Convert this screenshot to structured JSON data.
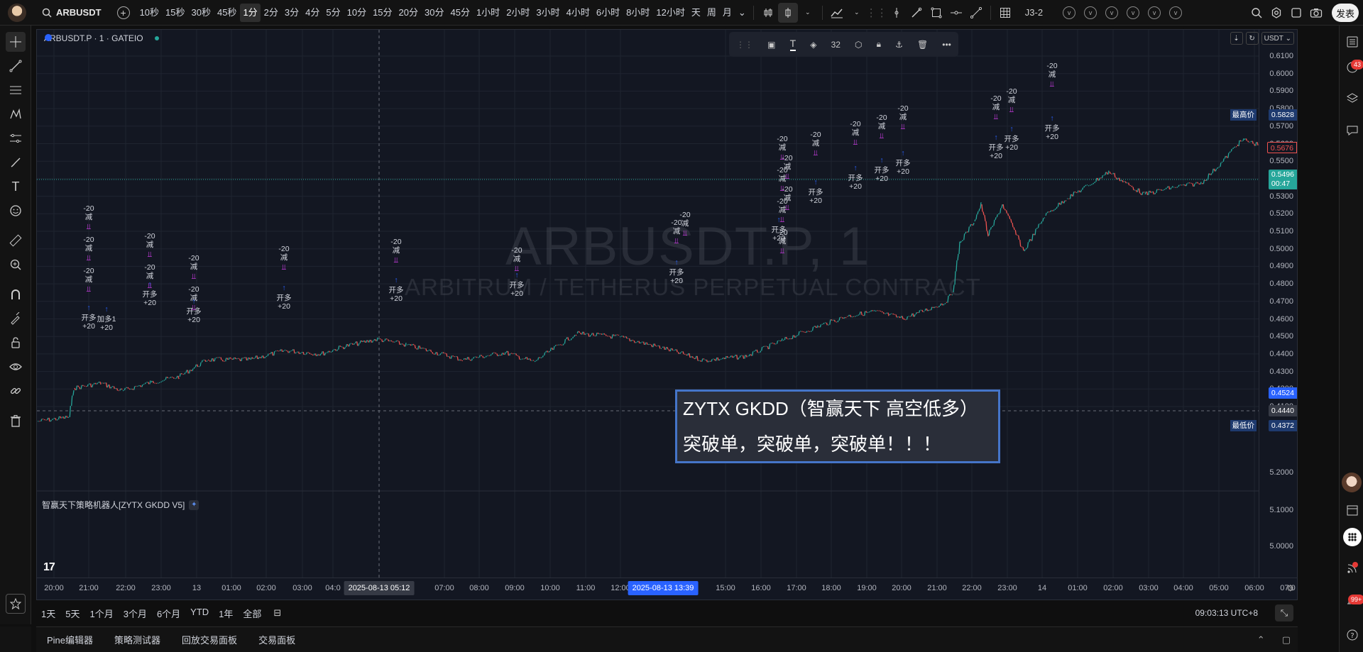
{
  "topbar": {
    "symbol": "ARBUSDT",
    "intervals": [
      "10秒",
      "15秒",
      "30秒",
      "45秒",
      "1分",
      "2分",
      "3分",
      "4分",
      "5分",
      "10分",
      "15分",
      "20分",
      "30分",
      "45分",
      "1小时",
      "2小时",
      "3小时",
      "4小时",
      "6小时",
      "8小时",
      "12小时",
      "天",
      "周",
      "月"
    ],
    "active_interval": "1分",
    "layout_name": "J3-2",
    "v_buttons": [
      "v",
      "v",
      "v",
      "v",
      "v",
      "v"
    ],
    "publish_label": "发表"
  },
  "chart": {
    "legend_title": "ARBUSDT.P · 1 · GATEIO",
    "watermark_symbol": "ARBUSDT.P, 1",
    "watermark_desc": "ARBITRUM / TETHERUS PERPETUAL CONTRACT",
    "floating_toolbar": {
      "size_value": "32"
    },
    "currency": "USDT",
    "price_ticks": [
      "0.6100",
      "0.6000",
      "0.5900",
      "0.5800",
      "0.5700",
      "0.5600",
      "0.5500",
      "0.5400",
      "0.5300",
      "0.5200",
      "0.5100",
      "0.5000",
      "0.4900",
      "0.4800",
      "0.4700",
      "0.4600",
      "0.4500",
      "0.4400",
      "0.4300",
      "0.4200",
      "0.4100"
    ],
    "indicator_ticks": [
      "5.2000",
      "5.1000",
      "5.0000"
    ],
    "labels": {
      "high_name": "最高价",
      "high_value": "0.5828",
      "prev_value": "0.5676",
      "last_value": "0.5496",
      "countdown": "00:47",
      "mid_value": "0.4524",
      "cross_value": "0.4440",
      "low_name": "最低价",
      "low_value": "0.4372"
    },
    "time_ticks": [
      "20:00",
      "21:00",
      "22:00",
      "23:00",
      "13",
      "01:00",
      "02:00",
      "03:00",
      "04:0",
      "07:00",
      "08:00",
      "09:00",
      "10:00",
      "11:00",
      "12:00",
      "15:00",
      "16:00",
      "17:00",
      "18:00",
      "19:00",
      "20:00",
      "21:00",
      "22:00",
      "23:00",
      "14",
      "01:00",
      "02:00",
      "03:00",
      "04:00",
      "05:00",
      "06:00",
      "07:0"
    ],
    "time_pill_cursor": "2025-08-13    05:12",
    "time_pill_selected": "2025-08-13    13:39",
    "indicator_name": "智赢天下策略机器人[ZYTX GKDD V5]",
    "callout_line1": "ZYTX GKDD（智赢天下 高空低多）",
    "callout_line2": "突破单，突破单，突破单！！！",
    "colors": {
      "up": "#26a69a",
      "down": "#ef5350",
      "accent": "#2962ff",
      "signal_short": "#e040fb",
      "signal_long": "#2962ff"
    }
  },
  "signals": {
    "minus20": "-20",
    "reduce": "减",
    "open_long": "开多",
    "plus20": "+20",
    "add_long": "加多1"
  },
  "rangebar": {
    "ranges": [
      "1天",
      "5天",
      "1个月",
      "3个月",
      "6个月",
      "YTD",
      "1年",
      "全部"
    ],
    "clock": "09:03:13 UTC+8"
  },
  "bottomtabs": [
    "Pine编辑器",
    "策略测试器",
    "回放交易面板",
    "交易面板"
  ],
  "rightbar": {
    "badge_alerts": "43",
    "badge_notif": "99+"
  }
}
